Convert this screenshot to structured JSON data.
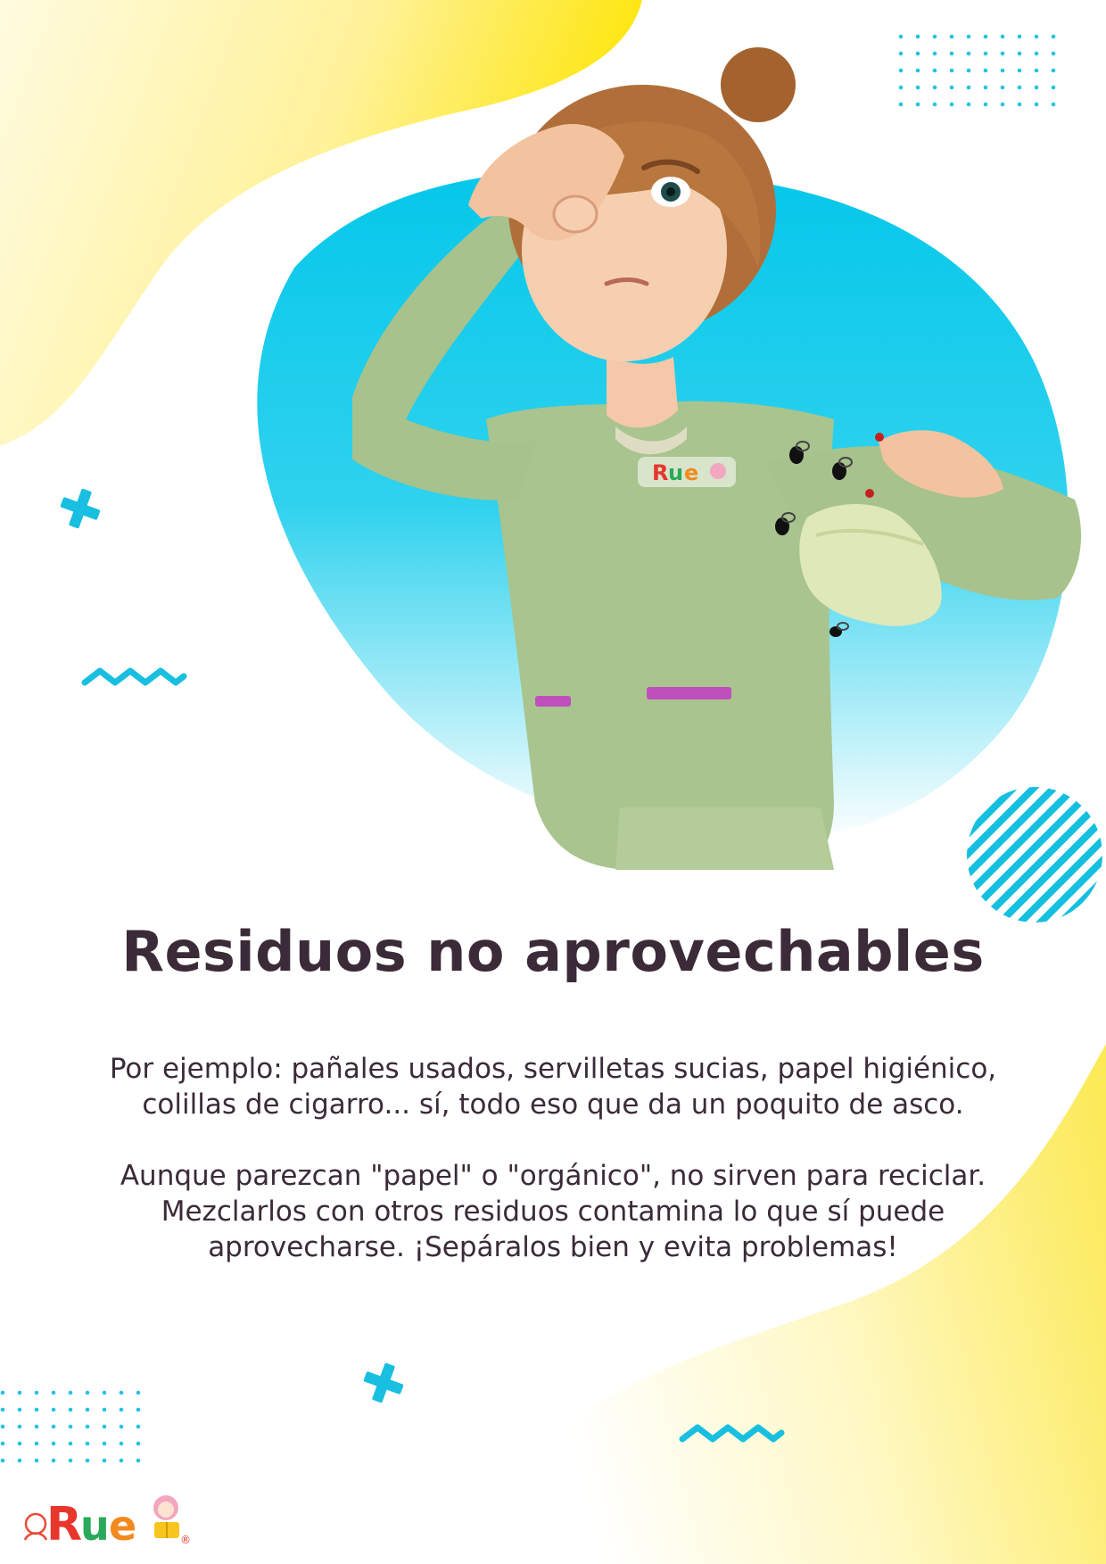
{
  "document": {
    "title": "Residuos no aprovechables",
    "paragraphs": [
      {
        "lines": [
          "Por ejemplo: pañales usados, servilletas sucias, papel higiénico,",
          "colillas de cigarro... sí, todo eso que da un poquito de asco."
        ]
      },
      {
        "lines": [
          "Aunque parezcan \"papel\" o \"orgánico\", no sirven para reciclar.",
          "Mezclarlos con otros residuos contamina lo que sí puede",
          "aprovecharse. ¡Sepáralos bien y evita problemas!"
        ]
      }
    ]
  },
  "brand": {
    "logo_text": "Rue",
    "registered_mark": "®"
  },
  "colors": {
    "title_text": "#3b2b38",
    "body_text": "#3b2b38",
    "cyan_accent": "#0fc6e6",
    "yellow_blob": "#fbe400",
    "shirt_green": "#a9c48e"
  }
}
